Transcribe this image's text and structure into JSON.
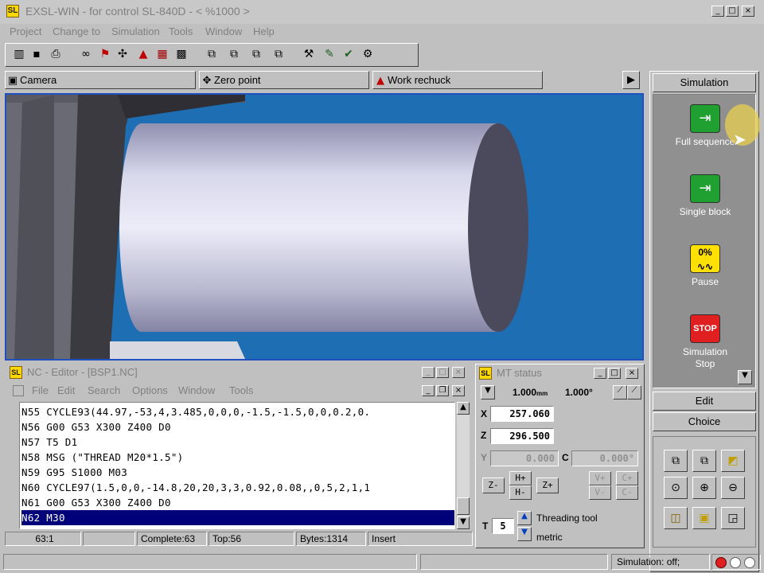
{
  "window": {
    "title": "EXSL-WIN - for control SL-840D - < %1000 >",
    "icon_label": "SL"
  },
  "menu": [
    "Project",
    "Change to",
    "Simulation",
    "Tools",
    "Window",
    "Help"
  ],
  "toolbar_icons": [
    "grid-icon",
    "save-icon",
    "print-icon",
    "glasses-icon",
    "flag-icon",
    "axes-icon",
    "workpiece-icon",
    "calendar-icon",
    "table-icon",
    "window1-icon",
    "window2-icon",
    "window3-icon",
    "window4-icon",
    "tool-icon",
    "clipboard-icon",
    "check-tool-icon",
    "wrench-icon"
  ],
  "tabs": [
    {
      "label": "Camera",
      "icon": "camera-icon"
    },
    {
      "label": "Zero point",
      "icon": "zero-point-icon"
    },
    {
      "label": "Work rechuck",
      "icon": "rechuck-icon"
    }
  ],
  "simulation": {
    "header": "Simulation",
    "buttons": [
      {
        "label": "Full sequence",
        "icon": "full-sequence-icon",
        "color": "#20a030"
      },
      {
        "label": "Single block",
        "icon": "single-block-icon",
        "color": "#20a030"
      },
      {
        "label": "Pause",
        "icon": "pause-icon",
        "color": "#ffe000",
        "icon_text": "0%"
      },
      {
        "label": "Simulation Stop",
        "icon": "stop-icon",
        "color": "#e02020",
        "icon_text": "STOP"
      }
    ],
    "edit": "Edit",
    "choice": "Choice"
  },
  "nc_editor": {
    "title": "NC - Editor - [BSP1.NC]",
    "icon_label": "SL",
    "menu": [
      "File",
      "Edit",
      "Search",
      "Options",
      "Window",
      "Tools"
    ],
    "lines": [
      "N55 CYCLE93(44.97,-53,4,3.485,0,0,0,-1.5,-1.5,0,0,0.2,0.",
      "N56 G00 G53 X300 Z400 D0",
      "N57 T5 D1",
      "N58 MSG (\"THREAD M20*1.5\")",
      "N59 G95 S1000 M03",
      "N60 CYCLE97(1.5,0,0,-14.8,20,20,3,3,0.92,0.08,,0,5,2,1,1",
      "N61 G00 G53 X300 Z400 D0",
      "N62 M30"
    ],
    "selected_line": 7,
    "status": {
      "pos": "63:1",
      "blank": "",
      "complete": "Complete:63",
      "top": "Top:56",
      "bytes": "Bytes:1314",
      "mode": "Insert"
    }
  },
  "mt_status": {
    "title": "MT status",
    "increment_linear": "1.000",
    "increment_unit_linear": "mm",
    "increment_angle": "1.000°",
    "x_label": "X",
    "x_value": "257.060",
    "z_label": "Z",
    "z_value": "296.500",
    "y_label": "Y",
    "y_value": "0.000",
    "c_label": "C",
    "c_value": "0.000°",
    "jog": {
      "z_minus": "Z-",
      "h_plus": "H+",
      "h_minus": "H-",
      "z_plus": "Z+",
      "v_plus": "V+",
      "v_minus": "V-",
      "c_plus": "C+",
      "c_minus": "C-"
    },
    "t_label": "T",
    "t_value": "5",
    "tool_name": "Threading tool",
    "tool_type": "metric"
  },
  "app_status": {
    "simulation": "Simulation: off;"
  }
}
